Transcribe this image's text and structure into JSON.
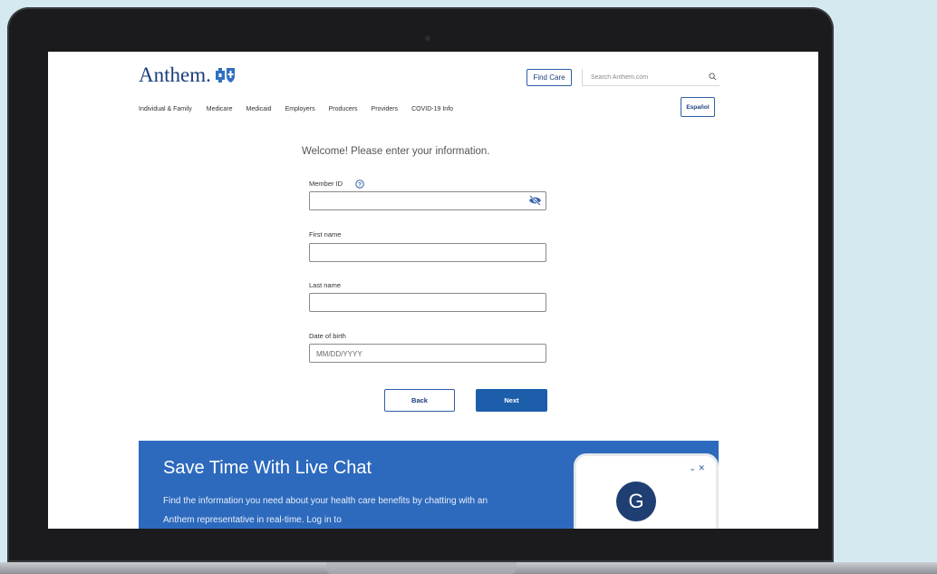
{
  "header": {
    "logo_text": "Anthem.",
    "find_care_label": "Find Care",
    "search_placeholder": "Search Anthem.com",
    "espanol_label": "Español"
  },
  "nav": {
    "items": [
      {
        "label": "Individual & Family"
      },
      {
        "label": "Medicare"
      },
      {
        "label": "Medicaid"
      },
      {
        "label": "Employers"
      },
      {
        "label": "Producers"
      },
      {
        "label": "Providers"
      },
      {
        "label": "COVID-19 Info"
      }
    ]
  },
  "form": {
    "heading": "Welcome! Please enter your information.",
    "member_id": {
      "label": "Member ID",
      "value": ""
    },
    "first_name": {
      "label": "First name",
      "value": ""
    },
    "last_name": {
      "label": "Last name",
      "value": ""
    },
    "dob": {
      "label": "Date of birth",
      "placeholder": "MM/DD/YYYY",
      "value": ""
    },
    "back_label": "Back",
    "next_label": "Next"
  },
  "banner": {
    "title": "Save Time With Live Chat",
    "body": "Find the information you need about your health care benefits by chatting with an Anthem representative in real-time. Log in to",
    "controls": "⌄ ✕",
    "avatar_letter": "G"
  },
  "colors": {
    "brand_blue": "#1a3d7c",
    "button_blue": "#1c5eaa",
    "banner_blue": "#2d6abd",
    "background": "#d5e9f1"
  }
}
